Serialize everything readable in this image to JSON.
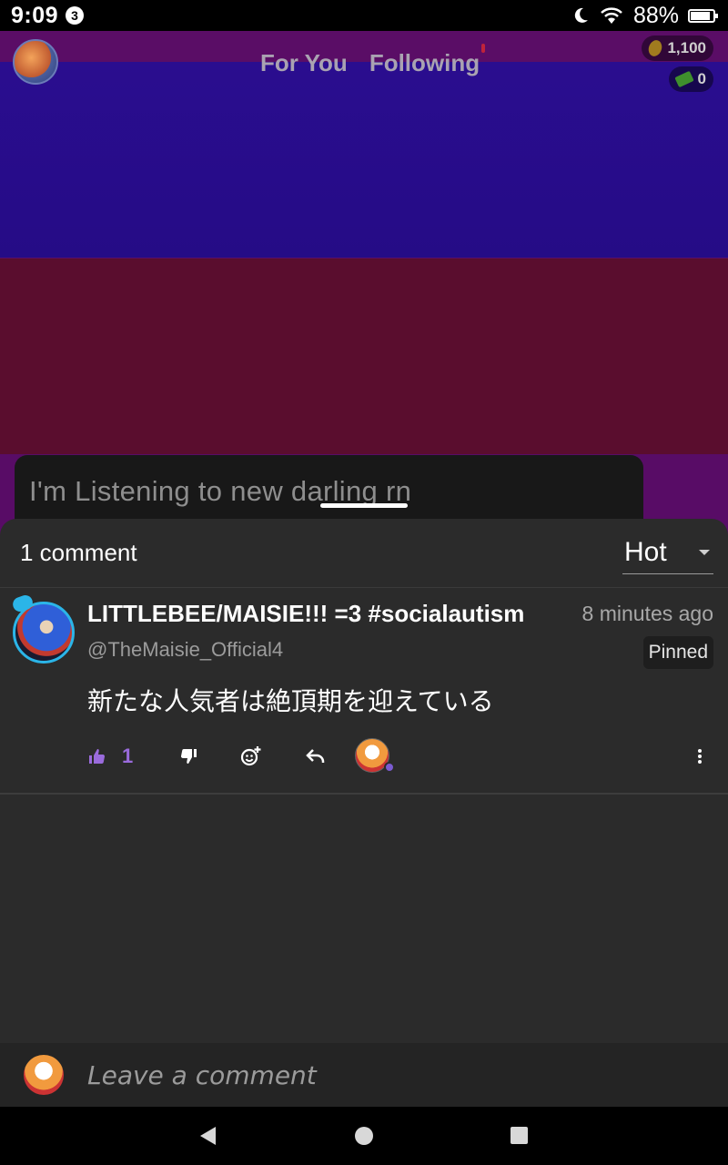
{
  "status_bar": {
    "time": "9:09",
    "notification_count": "3",
    "battery_text": "88%",
    "battery_level": 0.88
  },
  "feed": {
    "tabs": [
      {
        "label": "For You"
      },
      {
        "label": "Following"
      }
    ],
    "coins": "1,100",
    "cash": "0",
    "caption": "I'm Listening to new darling rn"
  },
  "comments": {
    "count_label": "1 comment",
    "sort_value": "Hot",
    "items": [
      {
        "name": "LITTLEBEE/MAISIE!!! =3 #socialautism",
        "time": "8 minutes ago",
        "handle": "@TheMaisie_Official4",
        "pinned": "Pinned",
        "body": "新たな人気者は絶頂期を迎えている",
        "likes": "1"
      }
    ],
    "input_placeholder": "Leave a comment"
  },
  "colors": {
    "accent": "#9a6bdc",
    "sheet_bg": "#2b2b2b",
    "avatar_ring": "#2bb5e8"
  }
}
